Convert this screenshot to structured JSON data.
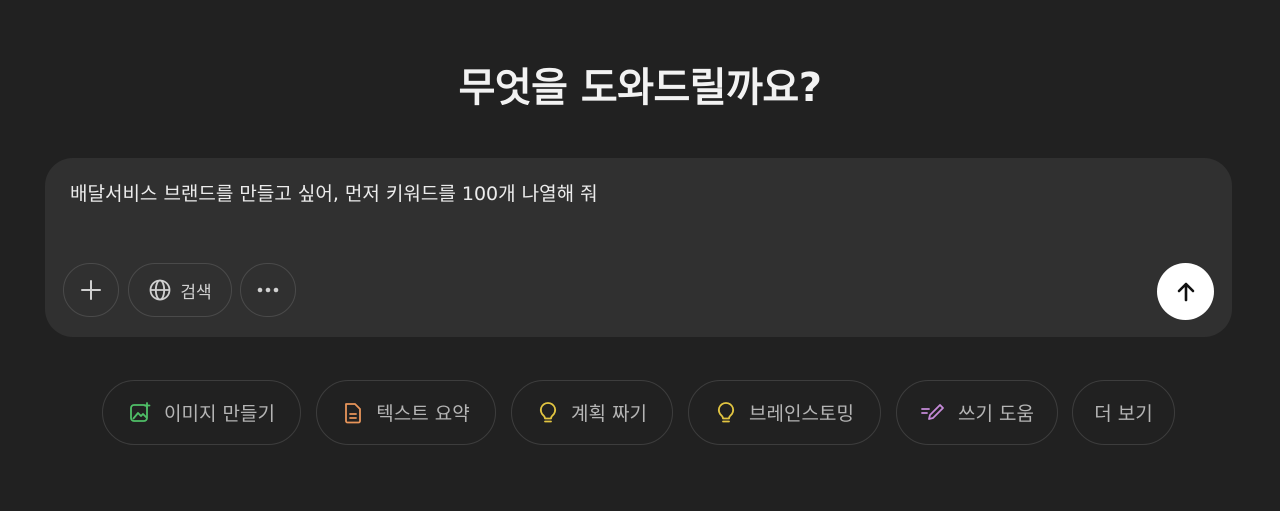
{
  "heading": "무엇을 도와드릴까요?",
  "composer": {
    "prompt_text": "배달서비스 브랜드를 만들고 싶어, 먼저 키워드를 100개 나열해 줘",
    "search_label": "검색"
  },
  "suggestions": {
    "image": "이미지 만들기",
    "summary": "텍스트 요약",
    "plan": "계획 짜기",
    "brainstorm": "브레인스토밍",
    "write": "쓰기 도움",
    "more": "더 보기"
  },
  "icons": {
    "add": "plus-icon",
    "search": "globe-icon",
    "more": "ellipsis-icon",
    "send": "arrow-up-icon",
    "image": "image-icon",
    "summary": "document-icon",
    "plan": "lightbulb-icon",
    "brainstorm": "lightbulb-icon",
    "write": "pen-icon"
  },
  "colors": {
    "background": "#212121",
    "composer": "#303030",
    "image_icon": "#4fbf67",
    "summary_icon": "#e8955a",
    "plan_icon": "#e2c541",
    "brainstorm_icon": "#e2c541",
    "write_icon": "#c58ad8"
  }
}
